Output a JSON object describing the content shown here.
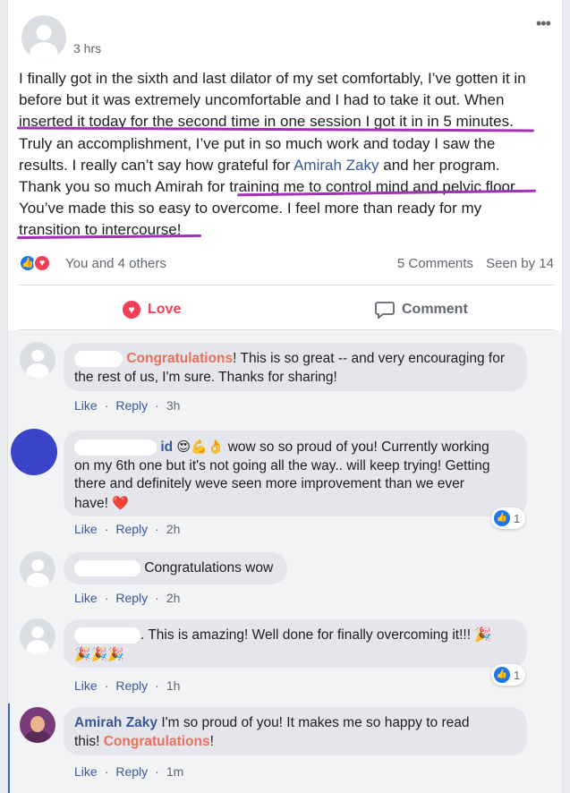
{
  "post": {
    "time": "3 hrs",
    "lines": [
      {
        "pre": "I finally got in the sixth and last dilator of my set comfortably, I’ve gotten it in",
        "mention": "",
        "post": ""
      },
      {
        "pre": "before but it was extremely uncomfortable and I had to take it out. When",
        "mention": "",
        "post": ""
      },
      {
        "pre": "inserted it today for the second time in one session I got it in in 5 minutes.",
        "mention": "",
        "post": ""
      },
      {
        "pre": "Truly an accomplishment, I’ve put in so much work and today I saw the",
        "mention": "",
        "post": ""
      },
      {
        "pre": "results. I really can’t say how grateful for ",
        "mention": "Amirah Zaky",
        "post": " and her program."
      },
      {
        "pre": "Thank you so much Amirah for training me to control mind and pelvic floor.",
        "mention": "",
        "post": ""
      },
      {
        "pre": "You’ve made this so easy to overcome. I feel more than ready for my",
        "mention": "",
        "post": ""
      },
      {
        "pre": "transition to intercourse!",
        "mention": "",
        "post": ""
      }
    ],
    "reactions_label": "You and 4 others",
    "comments_count": "5 Comments",
    "seen_by": "Seen by 14",
    "accent_underline_color": "#a231b5"
  },
  "actions": {
    "love_label": "Love",
    "comment_label": "Comment"
  },
  "comments": [
    {
      "highlight": "Congratulations",
      "text_line1": "! This is so great -- and very encouraging for",
      "text_line2": "the rest of us, I'm sure. Thanks for sharing!",
      "like": "Like",
      "reply": "Reply",
      "time": "3h"
    },
    {
      "name_tail": "id",
      "emoji": "😍💪👌",
      "text_line1": " wow so so proud of you! Currently working",
      "text_line2": "on my 6th one but it's not going all the way.. will keep trying! Getting",
      "text_line3": "there and definitely weve seen more improvement than we ever",
      "text_line4": "have!",
      "heart": "❤️",
      "like": "Like",
      "reply": "Reply",
      "time": "2h",
      "like_count": "1"
    },
    {
      "text_line1": "Congratulations wow",
      "like": "Like",
      "reply": "Reply",
      "time": "2h"
    },
    {
      "text_line1": ". This is amazing! Well done for finally overcoming it!!! 🎉",
      "text_line2": "🎉🎉🎉",
      "like": "Like",
      "reply": "Reply",
      "time": "1h",
      "like_count": "1"
    },
    {
      "name": "Amirah Zaky",
      "text_line1": " I'm so proud of you! It makes me so happy to read",
      "text_line2_pre": "this! ",
      "highlight": "Congratulations",
      "text_line2_post": "!",
      "like": "Like",
      "reply": "Reply",
      "time": "1m"
    }
  ],
  "colors": {
    "love": "#f33e58",
    "link": "#385898",
    "highlight": "#e9705a"
  }
}
